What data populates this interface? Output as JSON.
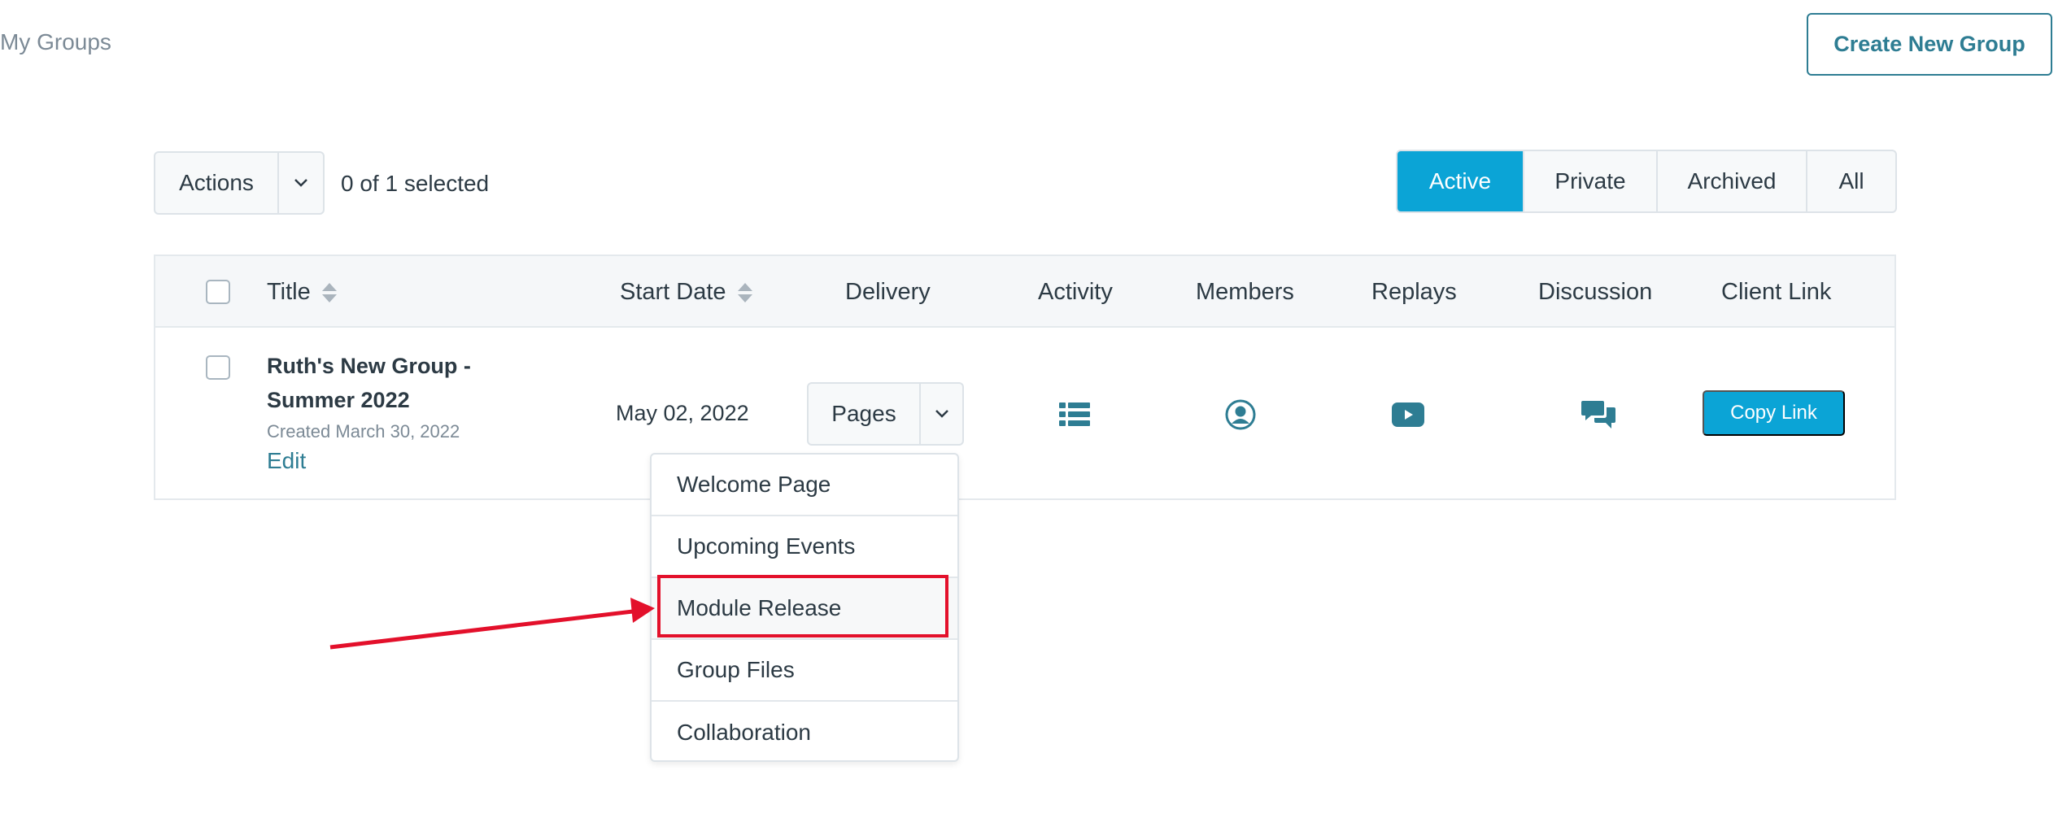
{
  "header": {
    "title": "My Groups",
    "create_button": "Create New Group"
  },
  "toolbar": {
    "actions_label": "Actions",
    "selected_text": "0 of 1 selected"
  },
  "filters": [
    {
      "label": "Active",
      "active": true
    },
    {
      "label": "Private",
      "active": false
    },
    {
      "label": "Archived",
      "active": false
    },
    {
      "label": "All",
      "active": false
    }
  ],
  "table": {
    "columns": [
      "Title",
      "Start Date",
      "Delivery",
      "Activity",
      "Members",
      "Replays",
      "Discussion",
      "Client Link"
    ],
    "rows": [
      {
        "title": "Ruth's New Group - Summer 2022",
        "created": "Created March 30, 2022",
        "edit": "Edit",
        "start_date": "May 02, 2022",
        "delivery": "Pages",
        "client_link": "Copy Link"
      }
    ]
  },
  "delivery_menu": {
    "items": [
      "Welcome Page",
      "Upcoming Events",
      "Module Release",
      "Group Files",
      "Collaboration"
    ],
    "highlighted": "Module Release"
  },
  "colors": {
    "accent": "#0ba4d6",
    "link": "#2e7d93",
    "annotation": "#e3102b",
    "icon": "#2e7d93"
  },
  "icons": {
    "activity": "list-icon",
    "members": "user-circle-icon",
    "replays": "play-icon",
    "discussion": "chat-bubbles-icon"
  }
}
